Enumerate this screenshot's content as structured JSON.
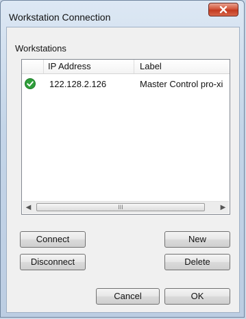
{
  "window": {
    "title": "Workstation Connection"
  },
  "group": {
    "label": "Workstations"
  },
  "table": {
    "columns": [
      "IP Address",
      "Label"
    ],
    "rows": [
      {
        "ip": "122.128.2.126",
        "label": "Master Control pro-xi",
        "status_icon": "connected-check-icon"
      }
    ]
  },
  "scrollbar": {
    "thumb_grip": "III"
  },
  "buttons": {
    "connect": "Connect",
    "disconnect": "Disconnect",
    "new": "New",
    "delete": "Delete",
    "cancel": "Cancel",
    "ok": "OK"
  },
  "colors": {
    "status_ok": "#2e9e3a",
    "close_button": "#c94a2f"
  }
}
